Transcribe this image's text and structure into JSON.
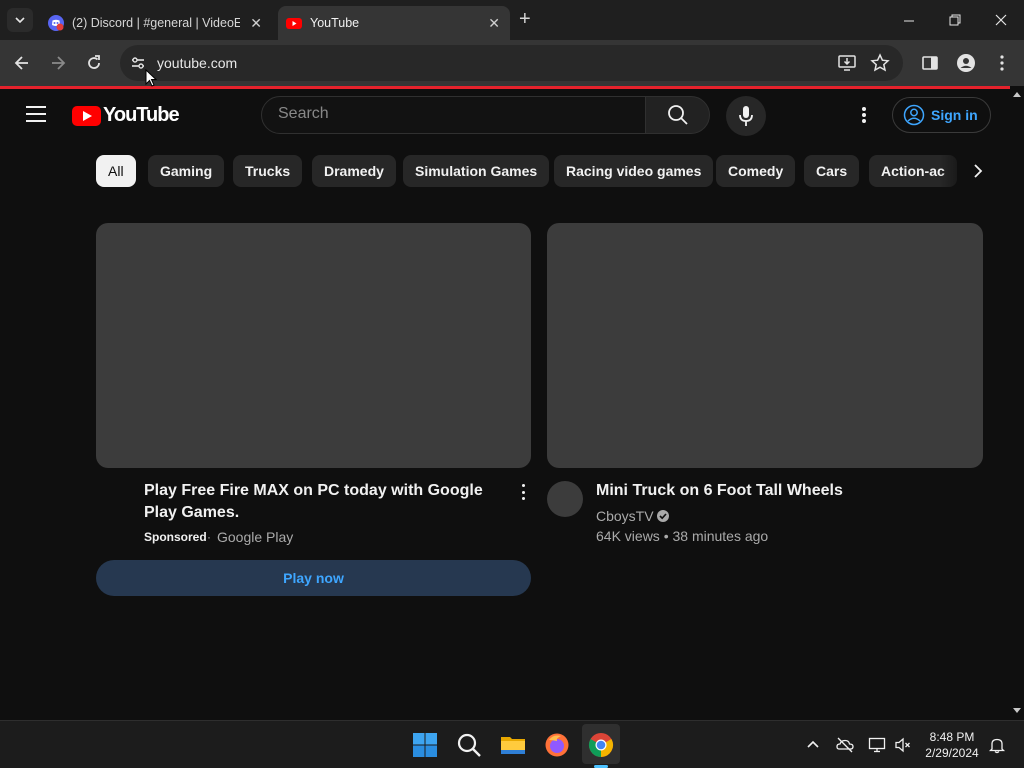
{
  "browser": {
    "tabs": [
      {
        "title": "(2) Discord | #general | VideoEd"
      },
      {
        "title": "YouTube"
      }
    ],
    "url": "youtube.com"
  },
  "youtube": {
    "logo_text": "YouTube",
    "search_placeholder": "Search",
    "signin_label": "Sign in",
    "chips": [
      "All",
      "Gaming",
      "Trucks",
      "Dramedy",
      "Simulation Games",
      "Racing video games",
      "Comedy",
      "Cars",
      "Action-ac"
    ],
    "ad": {
      "title": "Play Free Fire MAX on PC today with Google Play Games.",
      "sponsored_label": "Sponsored",
      "separator": "·",
      "advertiser": "Google Play",
      "cta": "Play now"
    },
    "video": {
      "title": "Mini Truck on 6 Foot Tall Wheels",
      "channel": "CboysTV",
      "stats": "64K views • 38 minutes ago"
    }
  },
  "taskbar": {
    "time": "8:48 PM",
    "date": "2/29/2024"
  },
  "colors": {
    "youtube_red": "#ff0000",
    "link_blue": "#3ea6ff",
    "background": "#0f0f0f"
  }
}
